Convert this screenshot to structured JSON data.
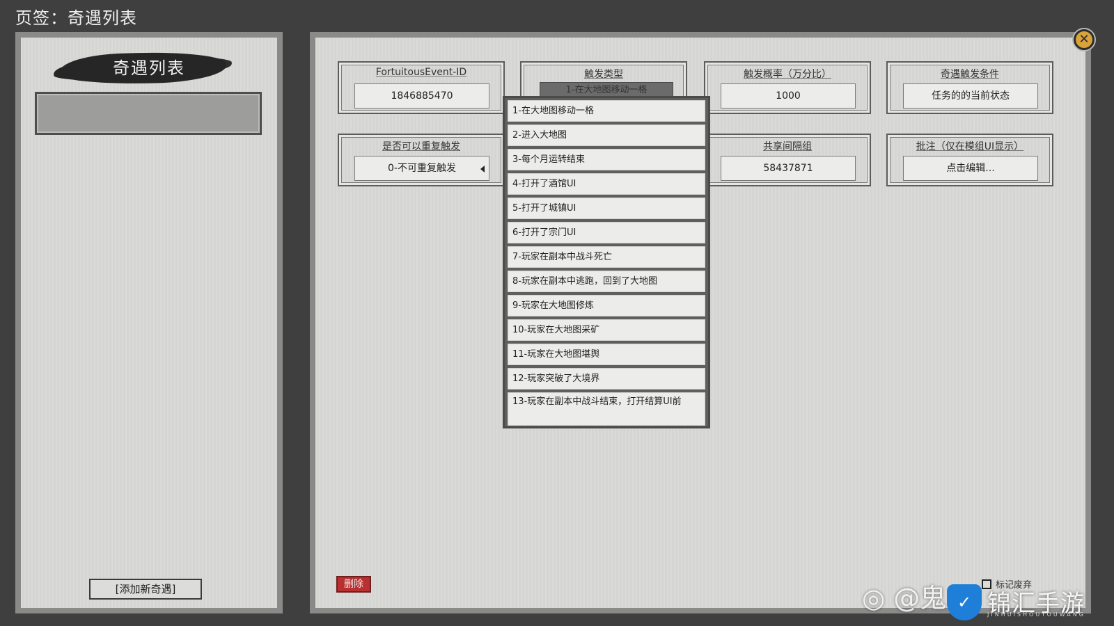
{
  "header": {
    "title": "页签：奇遇列表"
  },
  "left_panel": {
    "title": "奇遇列表",
    "add_button": "[添加新奇遇]"
  },
  "fields": {
    "event_id": {
      "label": "FortuitousEvent-ID",
      "value": "1846885470"
    },
    "trigger_type": {
      "label": "触发类型",
      "value": "1-在大地图移动一格"
    },
    "probability": {
      "label": "触发概率（万分比）",
      "value": "1000"
    },
    "condition": {
      "label": "奇遇触发条件",
      "value": "任务的的当前状态"
    },
    "repeatable": {
      "label": "是否可以重复触发",
      "value": "0-不可重复触发"
    },
    "share_group": {
      "label": "共享间隔组",
      "value": "58437871"
    },
    "note": {
      "label": "批注（仅在模组UI显示）",
      "value": "点击编辑..."
    }
  },
  "dropdown": {
    "options": [
      "1-在大地图移动一格",
      "2-进入大地图",
      "3-每个月运转结束",
      "4-打开了酒馆UI",
      "5-打开了城镇UI",
      "6-打开了宗门UI",
      "7-玩家在副本中战斗死亡",
      "8-玩家在副本中逃跑，回到了大地图",
      "9-玩家在大地图修炼",
      "10-玩家在大地图采矿",
      "11-玩家在大地图堪舆",
      "12-玩家突破了大境界",
      "13-玩家在副本中战斗结束，打开结算UI前"
    ]
  },
  "footer": {
    "delete_button": "删除",
    "deprecate_label": "标记废弃"
  },
  "watermark": {
    "handle": "@鬼",
    "logo_glyph": "✓",
    "brand": "锦汇手游",
    "brand_sub": "JINHUISHOUYOUWANG"
  },
  "colors": {
    "background": "#3f3f3f",
    "paper": "#d9d9d7",
    "delete": "#b83030",
    "close_accent": "#d9a23a"
  }
}
